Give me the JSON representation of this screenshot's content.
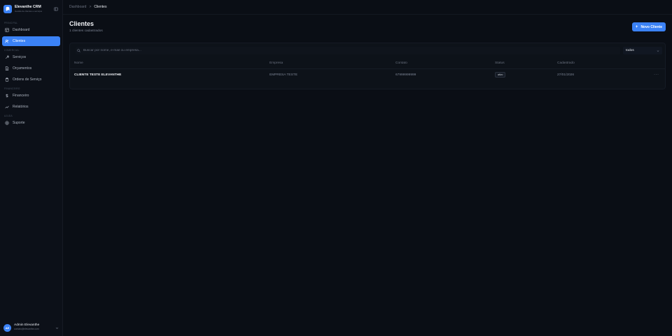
{
  "brand": {
    "name": "Elevanthe CRM",
    "subtitle": "Gestão de clientes e serviços"
  },
  "sidebar": {
    "sections": [
      {
        "label": "PRINCIPAL",
        "items": [
          {
            "label": "Dashboard",
            "icon": "dashboard-icon"
          },
          {
            "label": "Clientes",
            "icon": "users-icon",
            "active": true
          }
        ]
      },
      {
        "label": "COMERCIAL",
        "items": [
          {
            "label": "Serviços",
            "icon": "wrench-icon"
          },
          {
            "label": "Orçamentos",
            "icon": "file-icon"
          },
          {
            "label": "Ordens de Serviço",
            "icon": "clipboard-icon"
          }
        ]
      },
      {
        "label": "FINANCEIRO",
        "items": [
          {
            "label": "Financeiro",
            "icon": "dollar-icon"
          },
          {
            "label": "Relatórios",
            "icon": "chart-icon"
          }
        ]
      },
      {
        "label": "AJUDA",
        "items": [
          {
            "label": "Suporte",
            "icon": "support-icon"
          }
        ]
      }
    ]
  },
  "user": {
    "initials": "AE",
    "name": "Admin Elevanthe",
    "email": "contato@elevanthe.com"
  },
  "breadcrumb": {
    "parent": "Dashboard",
    "separator": ">",
    "current": "Clientes"
  },
  "page": {
    "title": "Clientes",
    "subtitle": "1 clientes cadastrados",
    "new_button": "Novo Cliente"
  },
  "filters": {
    "search_placeholder": "Buscar por nome, e-mail ou empresa...",
    "status_select": "todos"
  },
  "table": {
    "headers": [
      "Nome",
      "Empresa",
      "Contato",
      "Status",
      "Cadastrado"
    ],
    "rows": [
      {
        "nome": "CLIENTE TESTE ELEVANTHE",
        "empresa": "EMPRESA TESTE",
        "contato": "67999999999",
        "status": "ativo",
        "cadastrado": "27/01/2026"
      }
    ]
  },
  "colors": {
    "accent": "#3b82f6",
    "background": "#0a0e15"
  }
}
